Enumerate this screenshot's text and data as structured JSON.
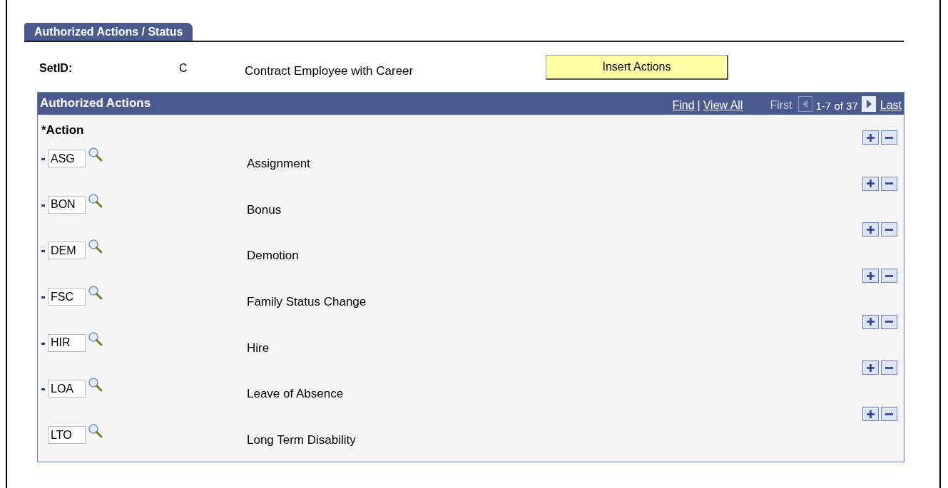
{
  "tabs": [
    {
      "label": "Authorized Actions / Status",
      "selected": true
    }
  ],
  "setid": {
    "label": "SetID:",
    "value": "C",
    "description": "Contract Employee with Career"
  },
  "insert_button": "Insert Actions",
  "grid": {
    "title": "Authorized Actions",
    "find": "Find",
    "separator": "|",
    "view_all": "View All",
    "first": "First",
    "range": "1-7 of 37",
    "last": "Last",
    "column": "*Action",
    "rows": [
      {
        "code": "ASG",
        "description": "Assignment",
        "marked": true
      },
      {
        "code": "BON",
        "description": "Bonus",
        "marked": true
      },
      {
        "code": "DEM",
        "description": "Demotion",
        "marked": true
      },
      {
        "code": "FSC",
        "description": "Family Status Change",
        "marked": true
      },
      {
        "code": "HIR",
        "description": "Hire",
        "marked": true
      },
      {
        "code": "LOA",
        "description": "Leave of Absence",
        "marked": true
      },
      {
        "code": "LTO",
        "description": "Long Term Disability",
        "marked": false
      }
    ]
  }
}
